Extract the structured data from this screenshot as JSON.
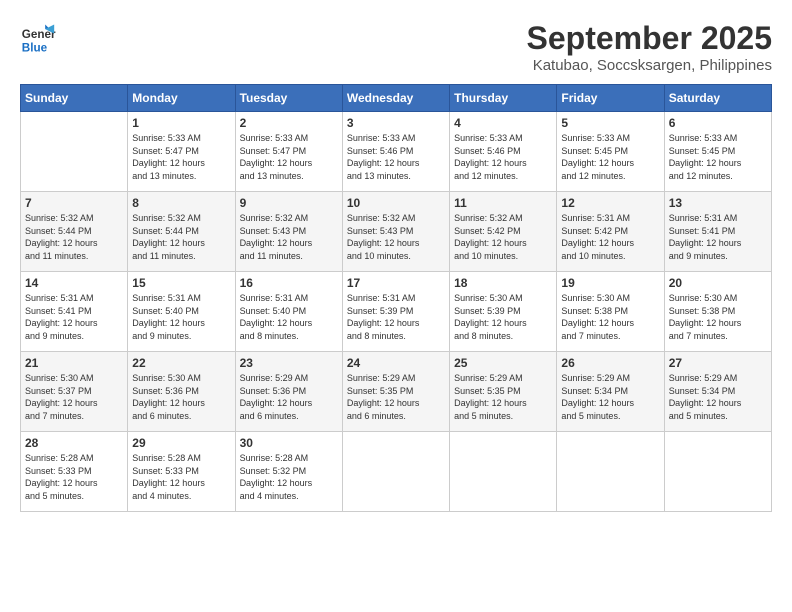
{
  "logo": {
    "line1": "General",
    "line2": "Blue"
  },
  "title": "September 2025",
  "location": "Katubao, Soccsksargen, Philippines",
  "days_header": [
    "Sunday",
    "Monday",
    "Tuesday",
    "Wednesday",
    "Thursday",
    "Friday",
    "Saturday"
  ],
  "weeks": [
    [
      {
        "day": "",
        "info": ""
      },
      {
        "day": "1",
        "info": "Sunrise: 5:33 AM\nSunset: 5:47 PM\nDaylight: 12 hours\nand 13 minutes."
      },
      {
        "day": "2",
        "info": "Sunrise: 5:33 AM\nSunset: 5:47 PM\nDaylight: 12 hours\nand 13 minutes."
      },
      {
        "day": "3",
        "info": "Sunrise: 5:33 AM\nSunset: 5:46 PM\nDaylight: 12 hours\nand 13 minutes."
      },
      {
        "day": "4",
        "info": "Sunrise: 5:33 AM\nSunset: 5:46 PM\nDaylight: 12 hours\nand 12 minutes."
      },
      {
        "day": "5",
        "info": "Sunrise: 5:33 AM\nSunset: 5:45 PM\nDaylight: 12 hours\nand 12 minutes."
      },
      {
        "day": "6",
        "info": "Sunrise: 5:33 AM\nSunset: 5:45 PM\nDaylight: 12 hours\nand 12 minutes."
      }
    ],
    [
      {
        "day": "7",
        "info": "Sunrise: 5:32 AM\nSunset: 5:44 PM\nDaylight: 12 hours\nand 11 minutes."
      },
      {
        "day": "8",
        "info": "Sunrise: 5:32 AM\nSunset: 5:44 PM\nDaylight: 12 hours\nand 11 minutes."
      },
      {
        "day": "9",
        "info": "Sunrise: 5:32 AM\nSunset: 5:43 PM\nDaylight: 12 hours\nand 11 minutes."
      },
      {
        "day": "10",
        "info": "Sunrise: 5:32 AM\nSunset: 5:43 PM\nDaylight: 12 hours\nand 10 minutes."
      },
      {
        "day": "11",
        "info": "Sunrise: 5:32 AM\nSunset: 5:42 PM\nDaylight: 12 hours\nand 10 minutes."
      },
      {
        "day": "12",
        "info": "Sunrise: 5:31 AM\nSunset: 5:42 PM\nDaylight: 12 hours\nand 10 minutes."
      },
      {
        "day": "13",
        "info": "Sunrise: 5:31 AM\nSunset: 5:41 PM\nDaylight: 12 hours\nand 9 minutes."
      }
    ],
    [
      {
        "day": "14",
        "info": "Sunrise: 5:31 AM\nSunset: 5:41 PM\nDaylight: 12 hours\nand 9 minutes."
      },
      {
        "day": "15",
        "info": "Sunrise: 5:31 AM\nSunset: 5:40 PM\nDaylight: 12 hours\nand 9 minutes."
      },
      {
        "day": "16",
        "info": "Sunrise: 5:31 AM\nSunset: 5:40 PM\nDaylight: 12 hours\nand 8 minutes."
      },
      {
        "day": "17",
        "info": "Sunrise: 5:31 AM\nSunset: 5:39 PM\nDaylight: 12 hours\nand 8 minutes."
      },
      {
        "day": "18",
        "info": "Sunrise: 5:30 AM\nSunset: 5:39 PM\nDaylight: 12 hours\nand 8 minutes."
      },
      {
        "day": "19",
        "info": "Sunrise: 5:30 AM\nSunset: 5:38 PM\nDaylight: 12 hours\nand 7 minutes."
      },
      {
        "day": "20",
        "info": "Sunrise: 5:30 AM\nSunset: 5:38 PM\nDaylight: 12 hours\nand 7 minutes."
      }
    ],
    [
      {
        "day": "21",
        "info": "Sunrise: 5:30 AM\nSunset: 5:37 PM\nDaylight: 12 hours\nand 7 minutes."
      },
      {
        "day": "22",
        "info": "Sunrise: 5:30 AM\nSunset: 5:36 PM\nDaylight: 12 hours\nand 6 minutes."
      },
      {
        "day": "23",
        "info": "Sunrise: 5:29 AM\nSunset: 5:36 PM\nDaylight: 12 hours\nand 6 minutes."
      },
      {
        "day": "24",
        "info": "Sunrise: 5:29 AM\nSunset: 5:35 PM\nDaylight: 12 hours\nand 6 minutes."
      },
      {
        "day": "25",
        "info": "Sunrise: 5:29 AM\nSunset: 5:35 PM\nDaylight: 12 hours\nand 5 minutes."
      },
      {
        "day": "26",
        "info": "Sunrise: 5:29 AM\nSunset: 5:34 PM\nDaylight: 12 hours\nand 5 minutes."
      },
      {
        "day": "27",
        "info": "Sunrise: 5:29 AM\nSunset: 5:34 PM\nDaylight: 12 hours\nand 5 minutes."
      }
    ],
    [
      {
        "day": "28",
        "info": "Sunrise: 5:28 AM\nSunset: 5:33 PM\nDaylight: 12 hours\nand 5 minutes."
      },
      {
        "day": "29",
        "info": "Sunrise: 5:28 AM\nSunset: 5:33 PM\nDaylight: 12 hours\nand 4 minutes."
      },
      {
        "day": "30",
        "info": "Sunrise: 5:28 AM\nSunset: 5:32 PM\nDaylight: 12 hours\nand 4 minutes."
      },
      {
        "day": "",
        "info": ""
      },
      {
        "day": "",
        "info": ""
      },
      {
        "day": "",
        "info": ""
      },
      {
        "day": "",
        "info": ""
      }
    ]
  ]
}
